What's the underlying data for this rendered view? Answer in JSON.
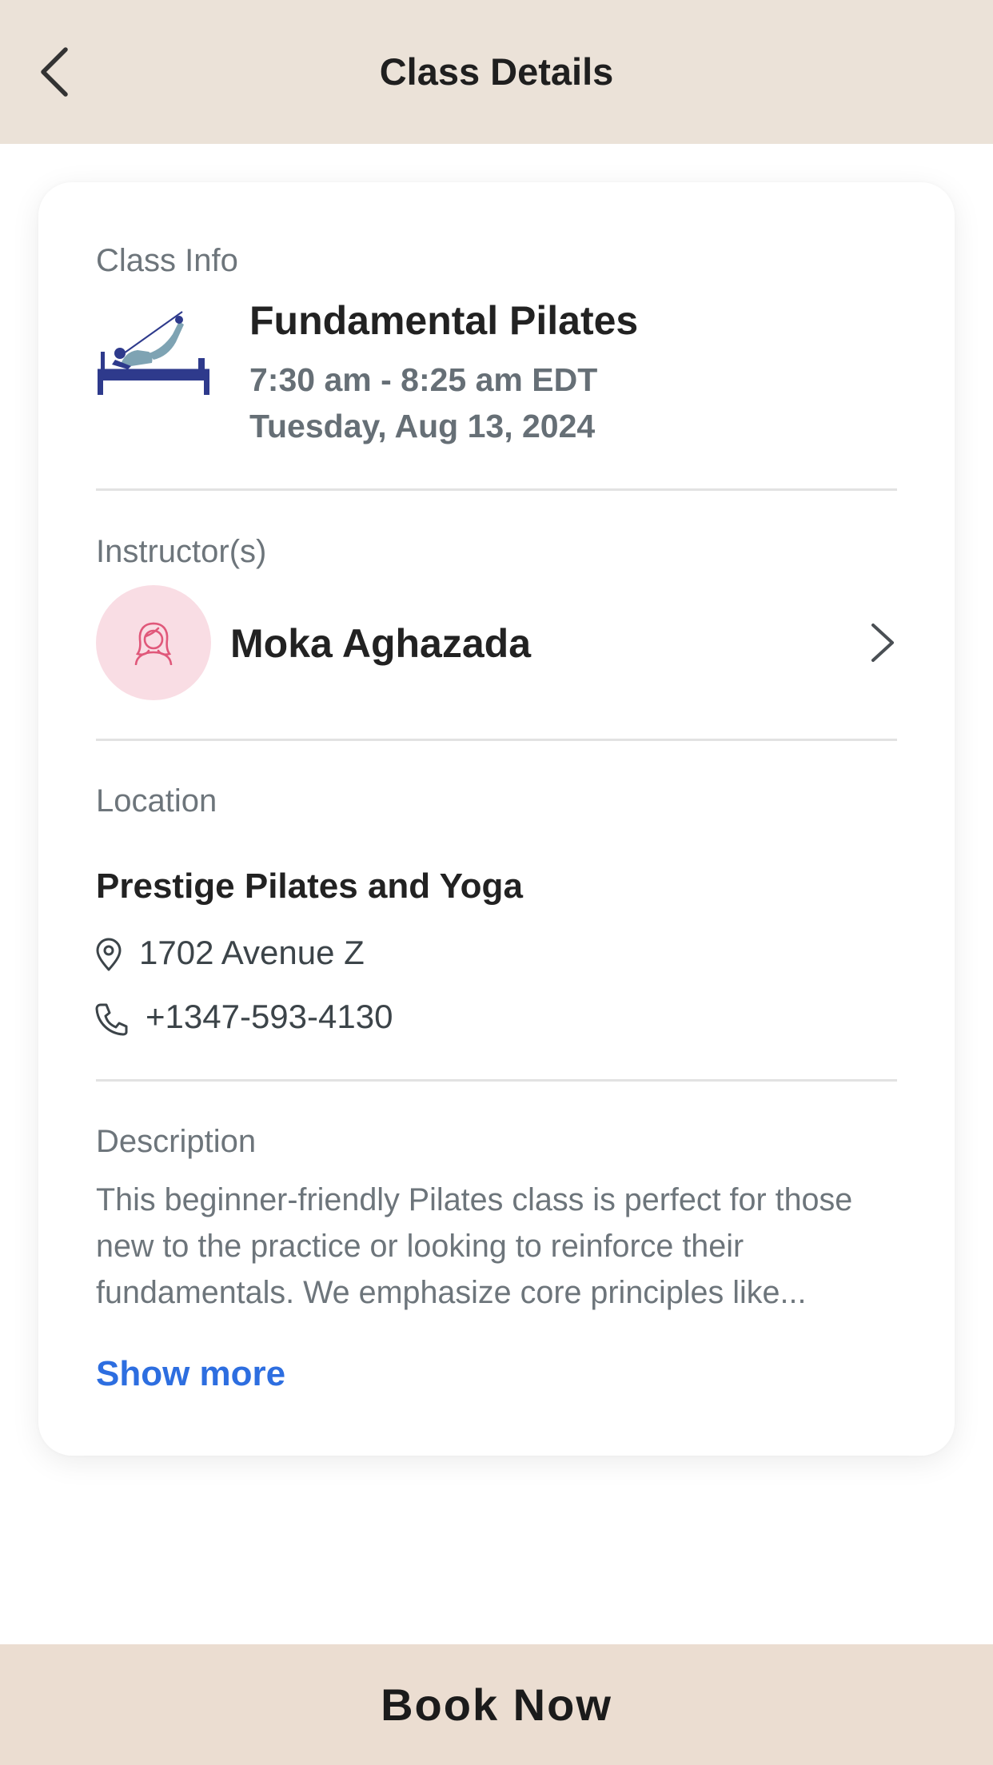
{
  "header": {
    "title": "Class Details",
    "back_icon": "chevron-left-icon"
  },
  "class_info": {
    "section_label": "Class Info",
    "name": "Fundamental Pilates",
    "time": "7:30 am - 8:25 am EDT",
    "date": "Tuesday, Aug 13, 2024",
    "icon": "pilates-reformer-illustration"
  },
  "instructors": {
    "section_label": "Instructor(s)",
    "items": [
      {
        "name": "Moka Aghazada",
        "avatar_icon": "woman-avatar-icon"
      }
    ]
  },
  "location": {
    "section_label": "Location",
    "studio_name": "Prestige Pilates and Yoga",
    "address": "1702 Avenue Z",
    "phone": "+1347-593-4130"
  },
  "description": {
    "section_label": "Description",
    "text": "This beginner-friendly Pilates class is perfect for those new to the practice or looking to reinforce their fundamentals. We emphasize core principles like...",
    "show_more_label": "Show more"
  },
  "footer": {
    "book_label": "Book Now"
  },
  "colors": {
    "header_bg": "#ebe2d8",
    "footer_bg": "#ebddd1",
    "link": "#2d6ee0",
    "avatar_bg": "#f9dde4",
    "avatar_stroke": "#e0587a",
    "illustration_navy": "#2e3a8c"
  }
}
